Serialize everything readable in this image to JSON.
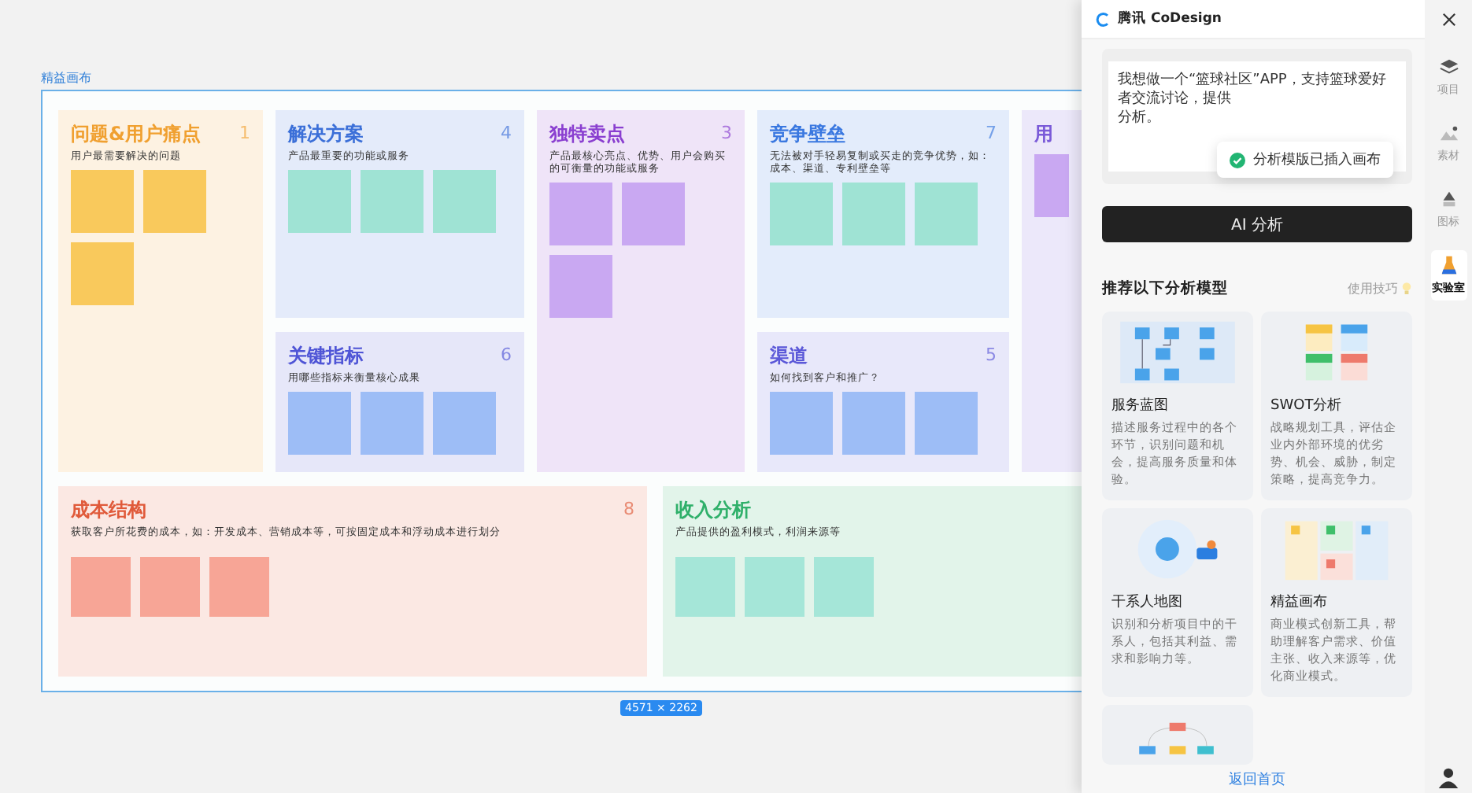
{
  "canvas": {
    "frame_label": "精益画布",
    "size_badge": "4571 × 2262",
    "panels": [
      {
        "title": "问题&用户痛点",
        "number": "1",
        "subtitle": "用户最需要解决的问题",
        "color": "#f0a030",
        "notes": [
          {
            "color": "#f9c95c"
          },
          {
            "color": "#f9c95c"
          },
          {
            "color": "#f9c95c"
          }
        ]
      },
      {
        "title": "解决方案",
        "number": "4",
        "subtitle": "产品最重要的功能或服务",
        "color": "#3b6fd8",
        "notes": [
          {
            "color": "#9fe3d4"
          },
          {
            "color": "#9fe3d4"
          },
          {
            "color": "#9fe3d4"
          }
        ]
      },
      {
        "title": "关键指标",
        "number": "6",
        "subtitle": "用哪些指标来衡量核心成果",
        "color": "#4f55d6",
        "notes": [
          {
            "color": "#9dbdf6"
          },
          {
            "color": "#9dbdf6"
          },
          {
            "color": "#9dbdf6"
          }
        ]
      },
      {
        "title": "独特卖点",
        "number": "3",
        "subtitle": "产品最核心亮点、优势、用户会购买的可衡量的功能或服务",
        "color": "#8a3fd0",
        "notes": [
          {
            "color": "#c9a8f2"
          },
          {
            "color": "#c9a8f2"
          },
          {
            "color": "#c9a8f2"
          }
        ]
      },
      {
        "title": "竞争壁垒",
        "number": "7",
        "subtitle": "无法被对手轻易复制或买走的竞争优势，如：成本、渠道、专利壁垒等",
        "color": "#3a78e0",
        "notes": [
          {
            "color": "#9fe3d4"
          },
          {
            "color": "#9fe3d4"
          },
          {
            "color": "#9fe3d4"
          }
        ]
      },
      {
        "title": "渠道",
        "number": "5",
        "subtitle": "如何找到客户和推广？",
        "color": "#5b58d8",
        "notes": [
          {
            "color": "#9dbdf6"
          },
          {
            "color": "#9dbdf6"
          },
          {
            "color": "#9dbdf6"
          }
        ]
      },
      {
        "title": "用",
        "color": "#7a5ad8",
        "notes": [
          {
            "color": "#c9a8f2"
          }
        ]
      }
    ],
    "bottom_panels": [
      {
        "title": "成本结构",
        "number": "8",
        "subtitle": "获取客户所花费的成本，如：开发成本、营销成本等，可按固定成本和浮动成本进行划分",
        "color": "#e05a3a",
        "notes": [
          {
            "color": "#f7a596"
          },
          {
            "color": "#f7a596"
          },
          {
            "color": "#f7a596"
          }
        ]
      },
      {
        "title": "收入分析",
        "subtitle": "产品提供的盈利模式，利润来源等",
        "color": "#2fb06a",
        "notes": [
          {
            "color": "#a5e6d8"
          },
          {
            "color": "#a5e6d8"
          },
          {
            "color": "#a5e6d8"
          }
        ]
      }
    ]
  },
  "assistant": {
    "brand": "腾讯 CoDesign",
    "prompt": "我想做一个“篮球社区”APP，支持篮球爱好者交流讨论，提供",
    "prompt_end": "分析。",
    "toast": "分析模版已插入画布",
    "analyze_button": "AI 分析",
    "section_title": "推荐以下分析模型",
    "tips_link": "使用技巧",
    "models": [
      {
        "kind": "blueprint",
        "title": "服务蓝图",
        "description": "描述服务过程中的各个环节，识别问题和机会，提高服务质量和体验。"
      },
      {
        "kind": "swot",
        "title": "SWOT分析",
        "description": "战略规划工具，评估企业内外部环境的优劣势、机会、威胁，制定策略，提高竞争力。"
      },
      {
        "kind": "stakeholder",
        "title": "干系人地图",
        "description": "识别和分析项目中的干系人，包括其利益、需求和影响力等。"
      },
      {
        "kind": "lean",
        "title": "精益画布",
        "description": "商业模式创新工具，帮助理解客户需求、价值主张、收入来源等，优化商业模式。"
      },
      {
        "kind": "flow"
      }
    ],
    "home_link": "返回首页"
  },
  "sidebar": {
    "items": [
      {
        "kind": "layers",
        "label": "项目",
        "selected": false
      },
      {
        "kind": "image",
        "label": "素材",
        "selected": false
      },
      {
        "kind": "shapes",
        "label": "图标",
        "selected": false
      },
      {
        "kind": "flask",
        "label": "实验室",
        "selected": true
      }
    ]
  }
}
